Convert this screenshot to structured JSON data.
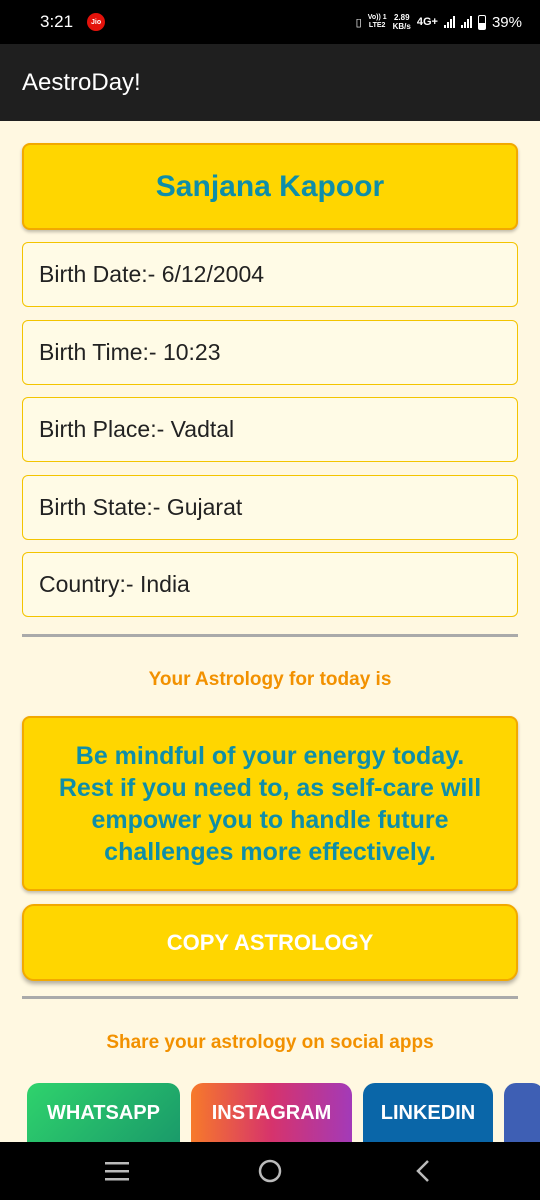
{
  "status_bar": {
    "time": "3:21",
    "carrier_badge": "Jio",
    "volte_line1": "Vo)) 1",
    "volte_line2": "LTE2",
    "speed_value": "2.89",
    "speed_unit": "KB/s",
    "network_type": "4G+",
    "battery": "39%",
    "battery_fraction": 0.39
  },
  "app_bar": {
    "title": "AestroDay!"
  },
  "profile": {
    "name": "Sanjana Kapoor",
    "fields": [
      "Birth Date:- 6/12/2004",
      "Birth Time:- 10:23",
      "Birth Place:- Vadtal",
      "Birth State:- Gujarat",
      "Country:- India"
    ]
  },
  "astrology": {
    "heading": "Your Astrology for today is",
    "text": "Be mindful of your energy today. Rest if you need to, as self-care will empower you to handle future challenges more effectively.",
    "copy_label": "COPY ASTROLOGY"
  },
  "share": {
    "heading": "Share your astrology on social apps",
    "buttons": [
      "WHATSAPP",
      "INSTAGRAM",
      "LINKEDIN"
    ]
  },
  "colors": {
    "accent_yellow": "#ffd600",
    "accent_border": "#f2a900",
    "title_teal": "#0f8ea8",
    "caption_orange": "#f29100",
    "background": "#fff8e1"
  }
}
